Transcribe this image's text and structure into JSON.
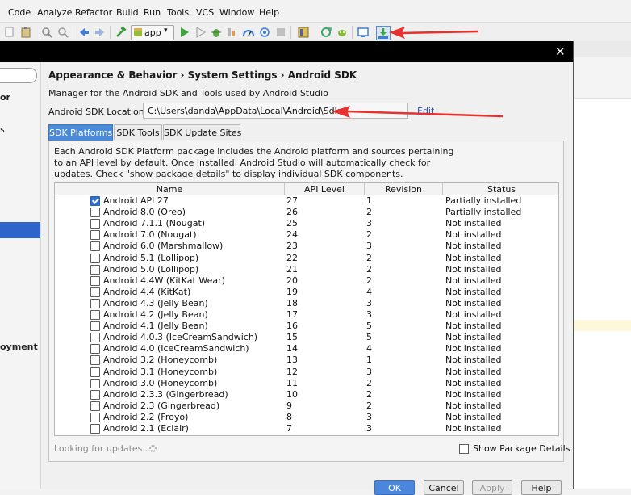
{
  "menubar": {
    "items": [
      "Code",
      "Analyze",
      "Refactor",
      "Build",
      "Run",
      "Tools",
      "VCS",
      "Window",
      "Help"
    ]
  },
  "toolbar": {
    "run_config": "app",
    "icons": [
      "copy-icon",
      "paste-icon",
      "find-icon",
      "replace-icon",
      "back-icon",
      "forward-icon",
      "make-icon",
      "run-icon",
      "debug-icon",
      "profile-icon",
      "stop-icon",
      "gradle-sync-icon",
      "avd-manager-icon",
      "sdk-manager-icon"
    ]
  },
  "dialog": {
    "breadcrumb": "Appearance & Behavior › System Settings › Android SDK",
    "description": "Manager for the Android SDK and Tools used by Android Studio",
    "sdk_location_label": "Android SDK Location:",
    "sdk_location_value": "C:\\Users\\danda\\AppData\\Local\\Android\\Sdk",
    "edit_label": "Edit",
    "left_panel": {
      "items": [
        "or",
        "s",
        "oyment"
      ]
    },
    "tabs": [
      {
        "label": "SDK Platforms",
        "active": true
      },
      {
        "label": "SDK Tools",
        "active": false
      },
      {
        "label": "SDK Update Sites",
        "active": false
      }
    ],
    "panel_description": "Each Android SDK Platform package includes the Android platform and sources pertaining to an API level by default. Once installed, Android Studio will automatically check for updates. Check \"show package details\" to display individual SDK components.",
    "table": {
      "columns": [
        "Name",
        "API Level",
        "Revision",
        "Status"
      ],
      "rows": [
        {
          "checked": true,
          "name": "Android API 27",
          "api": "27",
          "rev": "1",
          "status": "Partially installed"
        },
        {
          "checked": false,
          "name": "Android 8.0 (Oreo)",
          "api": "26",
          "rev": "2",
          "status": "Partially installed"
        },
        {
          "checked": false,
          "name": "Android 7.1.1 (Nougat)",
          "api": "25",
          "rev": "3",
          "status": "Not installed"
        },
        {
          "checked": false,
          "name": "Android 7.0 (Nougat)",
          "api": "24",
          "rev": "2",
          "status": "Not installed"
        },
        {
          "checked": false,
          "name": "Android 6.0 (Marshmallow)",
          "api": "23",
          "rev": "3",
          "status": "Not installed"
        },
        {
          "checked": false,
          "name": "Android 5.1 (Lollipop)",
          "api": "22",
          "rev": "2",
          "status": "Not installed"
        },
        {
          "checked": false,
          "name": "Android 5.0 (Lollipop)",
          "api": "21",
          "rev": "2",
          "status": "Not installed"
        },
        {
          "checked": false,
          "name": "Android 4.4W (KitKat Wear)",
          "api": "20",
          "rev": "2",
          "status": "Not installed"
        },
        {
          "checked": false,
          "name": "Android 4.4 (KitKat)",
          "api": "19",
          "rev": "4",
          "status": "Not installed"
        },
        {
          "checked": false,
          "name": "Android 4.3 (Jelly Bean)",
          "api": "18",
          "rev": "3",
          "status": "Not installed"
        },
        {
          "checked": false,
          "name": "Android 4.2 (Jelly Bean)",
          "api": "17",
          "rev": "3",
          "status": "Not installed"
        },
        {
          "checked": false,
          "name": "Android 4.1 (Jelly Bean)",
          "api": "16",
          "rev": "5",
          "status": "Not installed"
        },
        {
          "checked": false,
          "name": "Android 4.0.3 (IceCreamSandwich)",
          "api": "15",
          "rev": "5",
          "status": "Not installed"
        },
        {
          "checked": false,
          "name": "Android 4.0 (IceCreamSandwich)",
          "api": "14",
          "rev": "4",
          "status": "Not installed"
        },
        {
          "checked": false,
          "name": "Android 3.2 (Honeycomb)",
          "api": "13",
          "rev": "1",
          "status": "Not installed"
        },
        {
          "checked": false,
          "name": "Android 3.1 (Honeycomb)",
          "api": "12",
          "rev": "3",
          "status": "Not installed"
        },
        {
          "checked": false,
          "name": "Android 3.0 (Honeycomb)",
          "api": "11",
          "rev": "2",
          "status": "Not installed"
        },
        {
          "checked": false,
          "name": "Android 2.3.3 (Gingerbread)",
          "api": "10",
          "rev": "2",
          "status": "Not installed"
        },
        {
          "checked": false,
          "name": "Android 2.3 (Gingerbread)",
          "api": "9",
          "rev": "2",
          "status": "Not installed"
        },
        {
          "checked": false,
          "name": "Android 2.2 (Froyo)",
          "api": "8",
          "rev": "3",
          "status": "Not installed"
        },
        {
          "checked": false,
          "name": "Android 2.1 (Eclair)",
          "api": "7",
          "rev": "3",
          "status": "Not installed"
        }
      ]
    },
    "loading_text": "Looking for updates...",
    "show_details_label": "Show Package Details",
    "buttons": {
      "ok": "OK",
      "cancel": "Cancel",
      "apply": "Apply",
      "help": "Help"
    }
  },
  "colors": {
    "accent": "#2f65ca",
    "tab_active": "#4a8ad8",
    "annotation_arrow": "#e8302e",
    "link": "#2255cc"
  }
}
